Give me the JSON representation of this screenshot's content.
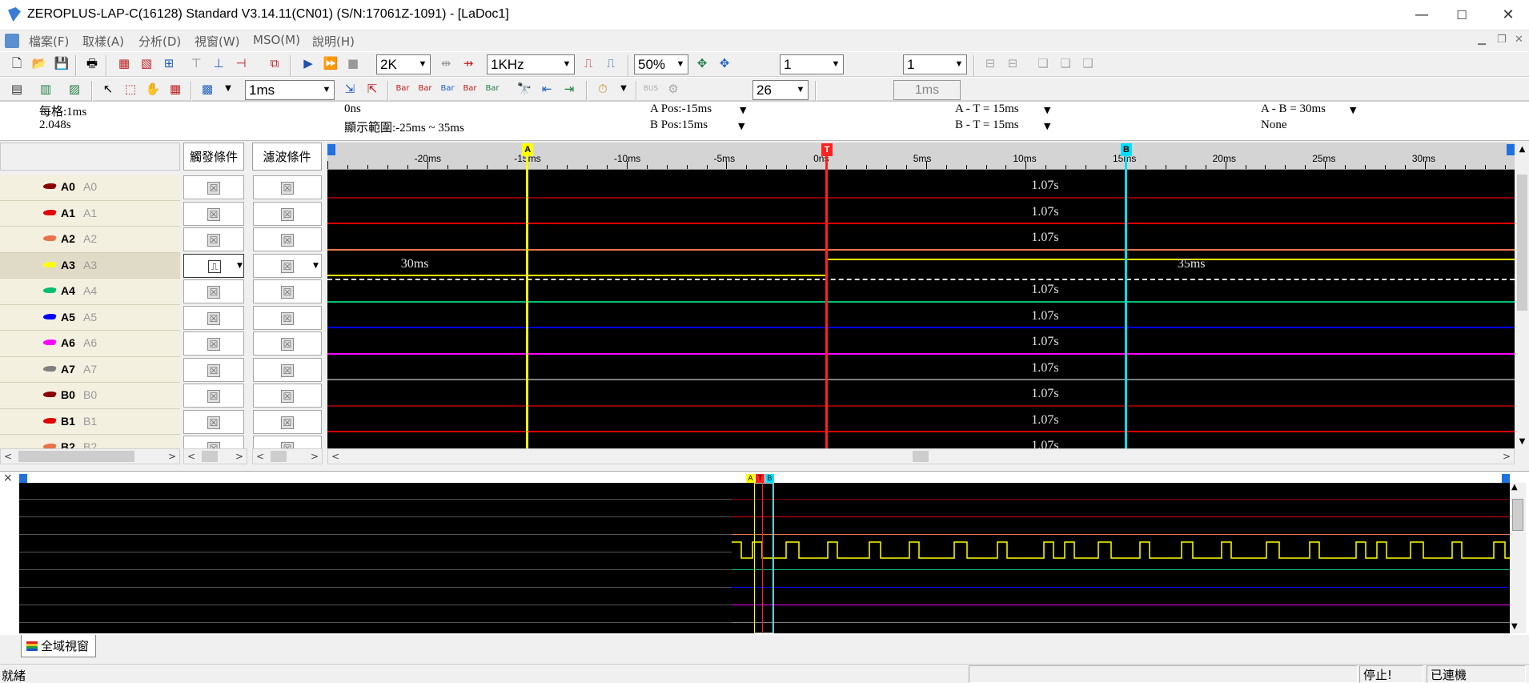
{
  "window": {
    "title": "ZEROPLUS-LAP-C(16128) Standard V3.14.11(CN01) (S/N:17061Z-1091) - [LaDoc1]",
    "minimize": "—",
    "maximize": "☐",
    "close": "✕"
  },
  "menu": [
    {
      "label": "檔案(F)"
    },
    {
      "label": "取樣(A)"
    },
    {
      "label": "分析(D)"
    },
    {
      "label": "視窗(W)"
    },
    {
      "label": "MSO(M)"
    },
    {
      "label": "說明(H)"
    }
  ],
  "toolbar1": {
    "sample_depth": "2K",
    "sample_rate": "1KHz",
    "trigger_position": "50%",
    "combo_a": "1",
    "combo_b": "1"
  },
  "toolbar2": {
    "time_per_div": "1ms",
    "font_size": "26",
    "delay_value": "1ms"
  },
  "info": {
    "per_div": "每格:1ms",
    "total": "2.048s",
    "trigger_time": "0ns",
    "display_range": "顯示範圍:-25ms ~ 35ms",
    "a_pos": "A Pos:-15ms",
    "b_pos": "B Pos:15ms",
    "a_minus_t": "A - T = 15ms",
    "b_minus_t": "B - T = 15ms",
    "a_minus_b": "A - B = 30ms",
    "a_minus_b_sub": "None"
  },
  "columns": {
    "trigger": "觸發條件",
    "filter": "濾波條件"
  },
  "signals": [
    {
      "name": "A0",
      "alias": "A0",
      "color": "#8b0000",
      "label": "1.07s",
      "selected": false
    },
    {
      "name": "A1",
      "alias": "A1",
      "color": "#e00000",
      "label": "1.07s",
      "selected": false
    },
    {
      "name": "A2",
      "alias": "A2",
      "color": "#e8734a",
      "label": "1.07s",
      "selected": false
    },
    {
      "name": "A3",
      "alias": "A3",
      "color": "#ffff00",
      "label": "",
      "selected": true
    },
    {
      "name": "A4",
      "alias": "A4",
      "color": "#00c070",
      "label": "1.07s",
      "selected": false
    },
    {
      "name": "A5",
      "alias": "A5",
      "color": "#0000ff",
      "label": "1.07s",
      "selected": false
    },
    {
      "name": "A6",
      "alias": "A6",
      "color": "#ff00ff",
      "label": "1.07s",
      "selected": false
    },
    {
      "name": "A7",
      "alias": "A7",
      "color": "#808080",
      "label": "1.07s",
      "selected": false
    },
    {
      "name": "B0",
      "alias": "B0",
      "color": "#8b0000",
      "label": "1.07s",
      "selected": false
    },
    {
      "name": "B1",
      "alias": "B1",
      "color": "#e00000",
      "label": "1.07s",
      "selected": false
    },
    {
      "name": "B2",
      "alias": "B2",
      "color": "#e8734a",
      "label": "1.07s",
      "selected": false
    }
  ],
  "a3_labels": {
    "low": "30ms",
    "high": "35ms"
  },
  "ruler": {
    "ticks": [
      {
        "label": "-20ms",
        "value": -20
      },
      {
        "label": "-15ms",
        "value": -15
      },
      {
        "label": "-10ms",
        "value": -10
      },
      {
        "label": "-5ms",
        "value": -5
      },
      {
        "label": "0ns",
        "value": 0
      },
      {
        "label": "5ms",
        "value": 5
      },
      {
        "label": "10ms",
        "value": 10
      },
      {
        "label": "15ms",
        "value": 15
      },
      {
        "label": "20ms",
        "value": 20
      },
      {
        "label": "25ms",
        "value": 25
      },
      {
        "label": "30ms",
        "value": 30
      }
    ],
    "range": [
      -25,
      34.5
    ],
    "cursors": [
      {
        "flag": "A",
        "value": -15,
        "color": "#ffff00"
      },
      {
        "flag": "T",
        "value": 0,
        "color": "#ff2020"
      },
      {
        "flag": "B",
        "value": 15,
        "color": "#00e0ff"
      }
    ]
  },
  "overview": {
    "flags": [
      "A",
      "T",
      "B"
    ]
  },
  "tabs": {
    "global_view": "全域視窗"
  },
  "status": {
    "ready": "就緒",
    "stopped": "停止!",
    "connected": "已連機"
  },
  "colors": {
    "trigger_cursor": "#ff2020",
    "cursor_a": "#ffff00",
    "cursor_b": "#00e0ff"
  }
}
